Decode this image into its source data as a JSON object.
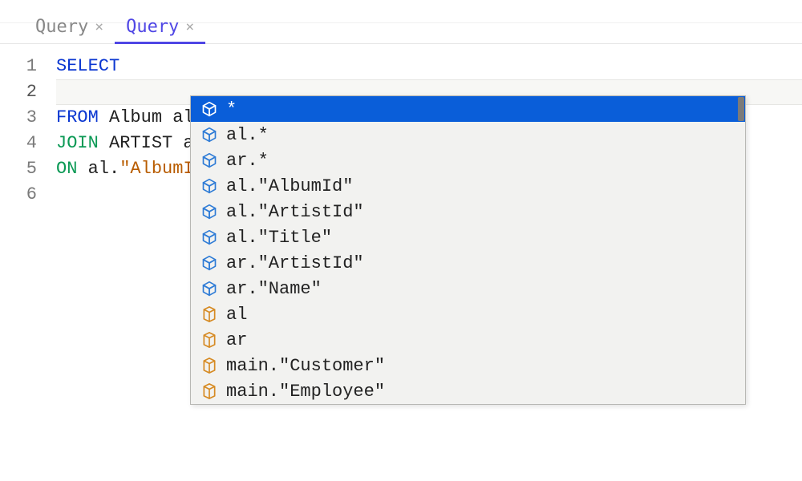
{
  "tabs": [
    {
      "label": "Query",
      "active": false
    },
    {
      "label": "Query",
      "active": true
    }
  ],
  "editor": {
    "lines": [
      {
        "n": "1",
        "tokens": [
          {
            "t": "SELECT",
            "c": "kw-select"
          }
        ]
      },
      {
        "n": "2",
        "tokens": [
          {
            "t": " ",
            "c": ""
          }
        ],
        "current": true
      },
      {
        "n": "3",
        "tokens": [
          {
            "t": "FROM",
            "c": "kw-from"
          },
          {
            "t": " Album al",
            "c": "kw-table"
          }
        ]
      },
      {
        "n": "4",
        "tokens": [
          {
            "t": "JOIN",
            "c": "kw-join"
          },
          {
            "t": " ARTIST ar",
            "c": "kw-table"
          }
        ]
      },
      {
        "n": "5",
        "tokens": [
          {
            "t": "ON",
            "c": "kw-on"
          },
          {
            "t": " al.",
            "c": "kw-table"
          },
          {
            "t": "\"AlbumId\"",
            "c": "kw-str"
          }
        ]
      },
      {
        "n": "6",
        "tokens": [
          {
            "t": "",
            "c": ""
          }
        ]
      }
    ]
  },
  "autocomplete": {
    "items": [
      {
        "label": "*",
        "icon": "column",
        "selected": true
      },
      {
        "label": "al.*",
        "icon": "column",
        "selected": false
      },
      {
        "label": "ar.*",
        "icon": "column",
        "selected": false
      },
      {
        "label": "al.\"AlbumId\"",
        "icon": "column",
        "selected": false
      },
      {
        "label": "al.\"ArtistId\"",
        "icon": "column",
        "selected": false
      },
      {
        "label": "al.\"Title\"",
        "icon": "column",
        "selected": false
      },
      {
        "label": "ar.\"ArtistId\"",
        "icon": "column",
        "selected": false
      },
      {
        "label": "ar.\"Name\"",
        "icon": "column",
        "selected": false
      },
      {
        "label": "al",
        "icon": "table",
        "selected": false
      },
      {
        "label": "ar",
        "icon": "table",
        "selected": false
      },
      {
        "label": "main.\"Customer\"",
        "icon": "table",
        "selected": false
      },
      {
        "label": "main.\"Employee\"",
        "icon": "table",
        "selected": false
      }
    ]
  }
}
